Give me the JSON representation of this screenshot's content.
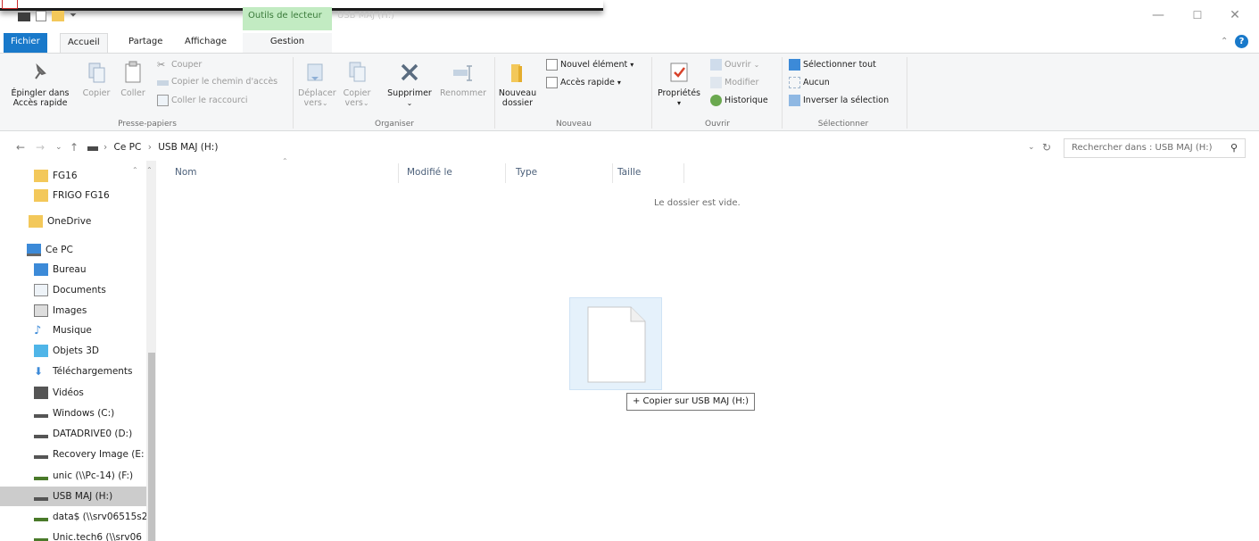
{
  "window": {
    "context_tab": "Outils de lecteur",
    "title": "USB MAJ (H:)",
    "min_symbol": "—",
    "max_symbol": "☐",
    "close_symbol": "✕"
  },
  "tabs": [
    {
      "label": "Fichier"
    },
    {
      "label": "Accueil"
    },
    {
      "label": "Partage"
    },
    {
      "label": "Affichage"
    },
    {
      "label": "Gestion"
    }
  ],
  "ribbon": {
    "presse_papiers": {
      "pin": "Épingler dans Accès rapide",
      "copy": "Copier",
      "paste": "Coller",
      "cut": "Couper",
      "copy_path": "Copier le chemin d'accès",
      "paste_shortcut": "Coller le raccourci",
      "label": "Presse-papiers"
    },
    "organiser": {
      "move": "Déplacer vers",
      "copy_to": "Copier vers",
      "delete": "Supprimer",
      "rename": "Renommer",
      "label": "Organiser"
    },
    "nouveau": {
      "new_folder": "Nouveau dossier",
      "new_item": "Nouvel élément",
      "quick_access": "Accès rapide",
      "label": "Nouveau"
    },
    "ouvrir": {
      "properties": "Propriétés",
      "open": "Ouvrir",
      "edit": "Modifier",
      "history": "Historique",
      "label": "Ouvrir"
    },
    "selectionner": {
      "select_all": "Sélectionner tout",
      "none": "Aucun",
      "invert": "Inverser la sélection",
      "label": "Sélectionner"
    }
  },
  "address": {
    "crumbs": [
      "Ce PC",
      "USB MAJ (H:)"
    ],
    "search_placeholder": "Rechercher dans : USB MAJ (H:)"
  },
  "sidebar": {
    "items": [
      {
        "label": "FG16",
        "icon": "folder-icon"
      },
      {
        "label": "FRIGO FG16",
        "icon": "folder-icon"
      },
      {
        "label": "OneDrive",
        "icon": "folder-icon"
      },
      {
        "label": "Ce PC",
        "icon": "computer-icon"
      },
      {
        "label": "Bureau",
        "icon": "desktop-icon"
      },
      {
        "label": "Documents",
        "icon": "documents-icon"
      },
      {
        "label": "Images",
        "icon": "images-icon"
      },
      {
        "label": "Musique",
        "icon": "music-icon"
      },
      {
        "label": "Objets 3D",
        "icon": "objects3d-icon"
      },
      {
        "label": "Téléchargements",
        "icon": "downloads-icon"
      },
      {
        "label": "Vidéos",
        "icon": "videos-icon"
      },
      {
        "label": "Windows (C:)",
        "icon": "drive-icon"
      },
      {
        "label": "DATADRIVE0 (D:)",
        "icon": "drive-icon"
      },
      {
        "label": "Recovery Image (E:",
        "icon": "drive-icon"
      },
      {
        "label": "unic (\\\\Pc-14) (F:)",
        "icon": "network-drive-icon"
      },
      {
        "label": "USB MAJ (H:)",
        "icon": "drive-icon",
        "selected": true
      },
      {
        "label": "data$ (\\\\srv06515s2",
        "icon": "network-drive-icon"
      },
      {
        "label": "Unic.tech6 (\\\\srv06",
        "icon": "network-drive-icon"
      }
    ]
  },
  "content": {
    "columns": [
      "Nom",
      "Modifié le",
      "Type",
      "Taille"
    ],
    "empty_message": "Le dossier est vide.",
    "drag_tooltip": "+ Copier sur USB MAJ (H:)"
  }
}
